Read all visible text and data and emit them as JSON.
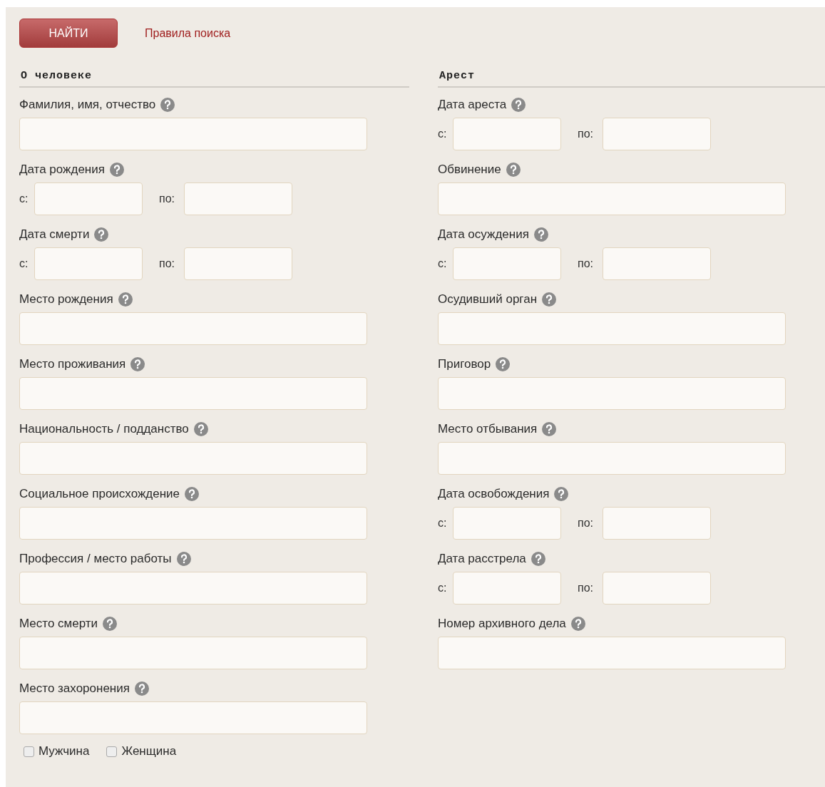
{
  "search_button": "НАЙТИ",
  "rules_link": "Правила поиска",
  "sections": [
    {
      "title": "О человеке",
      "fields": [
        {
          "kind": "text",
          "label": "Фамилия, имя, отчество"
        },
        {
          "kind": "range",
          "label": "Дата рождения",
          "from": "с:",
          "to": "по:"
        },
        {
          "kind": "range",
          "label": "Дата смерти",
          "from": "с:",
          "to": "по:"
        },
        {
          "kind": "text",
          "label": "Место рождения"
        },
        {
          "kind": "text",
          "label": "Место проживания"
        },
        {
          "kind": "text",
          "label": "Национальность / подданство"
        },
        {
          "kind": "text",
          "label": "Социальное происхождение"
        },
        {
          "kind": "text",
          "label": "Профессия / место работы"
        },
        {
          "kind": "text",
          "label": "Место смерти"
        },
        {
          "kind": "text",
          "label": "Место захоронения"
        }
      ],
      "checkboxes": [
        {
          "label": "Мужчина",
          "checked": false
        },
        {
          "label": "Женщина",
          "checked": false
        }
      ]
    },
    {
      "title": "Арест",
      "fields": [
        {
          "kind": "range",
          "label": "Дата ареста",
          "from": "с:",
          "to": "по:"
        },
        {
          "kind": "text",
          "label": "Обвинение"
        },
        {
          "kind": "range",
          "label": "Дата осуждения",
          "from": "с:",
          "to": "по:"
        },
        {
          "kind": "text",
          "label": "Осудивший орган"
        },
        {
          "kind": "text",
          "label": "Приговор"
        },
        {
          "kind": "text",
          "label": "Место отбывания"
        },
        {
          "kind": "range",
          "label": "Дата освобождения",
          "from": "с:",
          "to": "по:"
        },
        {
          "kind": "range",
          "label": "Дата расстрела",
          "from": "с:",
          "to": "по:"
        },
        {
          "kind": "text",
          "label": "Номер архивного дела"
        }
      ]
    }
  ]
}
